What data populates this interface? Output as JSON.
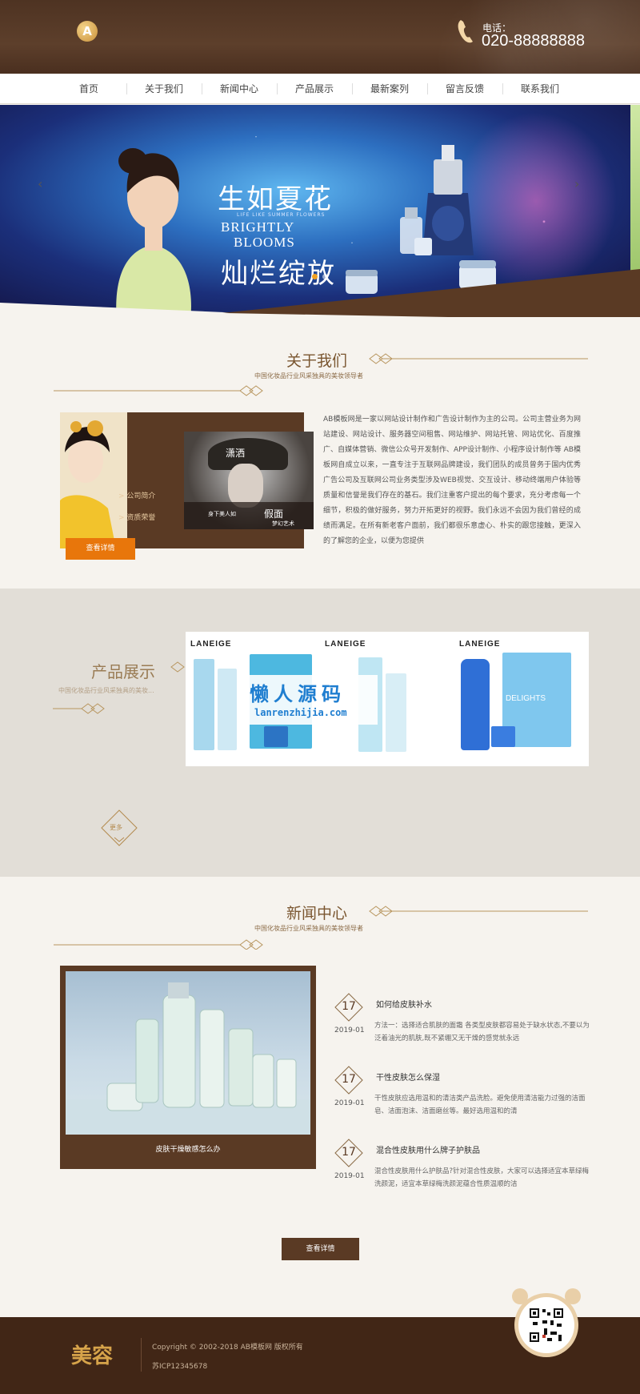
{
  "header": {
    "logo_letter": "A",
    "phone_label": "电话：",
    "phone_number": "020-88888888"
  },
  "nav": {
    "items": [
      "首页",
      "关于我们",
      "新闻中心",
      "产品展示",
      "最新案列",
      "留言反馈",
      "联系我们"
    ]
  },
  "banner": {
    "headline_cn_1": "生如夏花",
    "small_en": "LIFE LIKE SUMMER FLOWERS",
    "headline_en_1": "BRIGHTLY",
    "headline_en_2": "BLOOMS",
    "headline_cn_2": "灿烂绽放",
    "prev_arrow": "‹",
    "next_arrow": "›"
  },
  "about": {
    "title": "关于我们",
    "subtitle": "中国化妆品行业风采独具的美妆领导者",
    "links": [
      "> 公司简介",
      "> 资质荣誉"
    ],
    "button": "查看详情",
    "photo_caption_top": "潇洒",
    "photo_caption_left": "身下美人如",
    "photo_caption_big": "假面",
    "photo_caption_small": "梦幻艺术",
    "text": "AB模板网是一家以网站设计制作和广告设计制作为主的公司。公司主营业务为网站建设、网站设计、服务器空间租售、网站维护、网站托管、网站优化、百度推广、自媒体营销、微信公众号开发制作、APP设计制作、小程序设计制作等 AB模板网自成立以来，一直专注于互联网品牌建设，我们团队的成员曾务于国内优秀广告公司及互联网公司业务类型涉及WEB视觉、交互设计、移动终端用户体验等质量和信誉是我们存在的基石。我们注重客户提出的每个要求，充分考虑每一个细节，积极的做好服务，努力开拓更好的视野。我们永远不会因为我们曾经的成绩而满足。在所有新老客户面前，我们都很乐意虚心、朴实的跟您接触，更深入的了解您的企业，以便为您提供"
  },
  "products": {
    "title": "产品展示",
    "subtitle": "中国化妆品行业风采独具的美妆...",
    "brands": [
      "LANEIGE",
      "LANEIGE",
      "LANEIGE"
    ],
    "box_label": "DELIGHTS",
    "watermark_cn": "懒人源码",
    "watermark_en": "lanrenzhijia.com",
    "more_label": "更多"
  },
  "news": {
    "title": "新闻中心",
    "subtitle": "中国化妆品行业风采独具的美妆领导者",
    "photo_caption": "皮肤干燥敏感怎么办",
    "items": [
      {
        "day": "17",
        "date": "2019-01",
        "title": "如何给皮肤补水",
        "desc": "方法一：选择适合肌肤的面霜 各类型皮肤都容易处于缺水状态,不要以为泛着油光的肌肤,既不紧绷又无干燥的感觉就永远"
      },
      {
        "day": "17",
        "date": "2019-01",
        "title": "干性皮肤怎么保湿",
        "desc": "干性皮肤应选用温和的清洁类产品洗脸。避免使用清洁能力过强的洁面皂、洁面泡沫、洁面磨丝等。最好选用温和的清"
      },
      {
        "day": "17",
        "date": "2019-01",
        "title": "混合性皮肤用什么牌子护肤品",
        "desc": "混合性皮肤用什么护肤品?针对混合性皮肤，大家可以选择适宜本草绿梅洗颜泥，适宜本草绿梅洗颜泥蕴合性质温顺的洁"
      }
    ],
    "button": "查看详情"
  },
  "footer": {
    "brand": "美容",
    "copyright": "Copyright © 2002-2018 AB模板网 版权所有",
    "icp": "苏ICP12345678"
  },
  "colors": {
    "brown": "#5a3a24",
    "dark_brown": "#412616",
    "orange": "#e8760b",
    "gold": "#b38a4e"
  }
}
